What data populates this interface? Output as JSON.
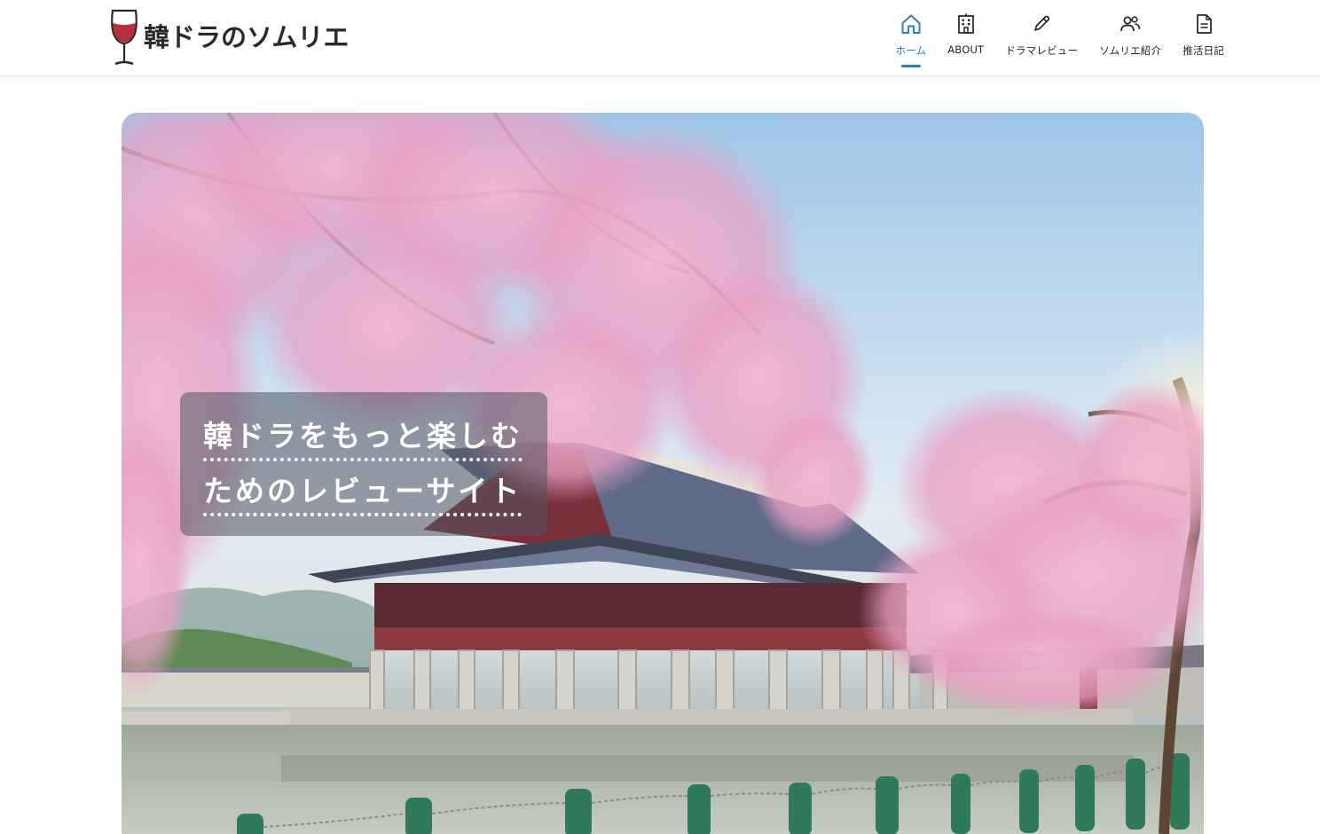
{
  "site": {
    "logo_text": "韓ドラのソムリエ"
  },
  "nav": {
    "items": [
      {
        "label": "ホーム",
        "icon": "home-icon",
        "active": true
      },
      {
        "label": "ABOUT",
        "icon": "building-icon",
        "active": false
      },
      {
        "label": "ドラマレビュー",
        "icon": "pencil-icon",
        "active": false
      },
      {
        "label": "ソムリエ紹介",
        "icon": "users-icon",
        "active": false
      },
      {
        "label": "推活日記",
        "icon": "document-icon",
        "active": false
      }
    ]
  },
  "hero": {
    "caption_line1": "韓ドラをもっと楽しむ",
    "caption_line2": "ためのレビューサイト"
  },
  "colors": {
    "accent": "#2b7bc0",
    "wine": "#b3313e",
    "text": "#222222",
    "caption_bg": "#50566285"
  }
}
